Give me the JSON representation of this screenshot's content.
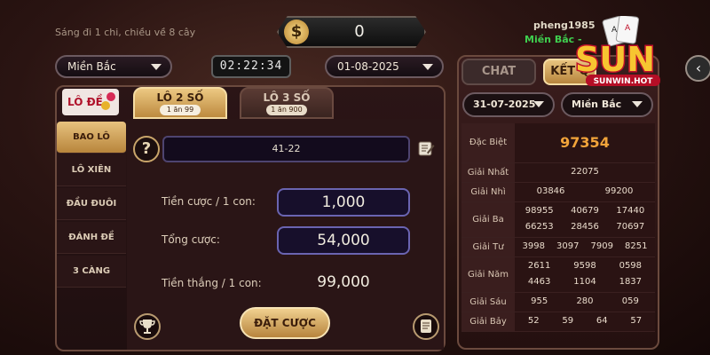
{
  "header": {
    "marquee": "Sáng đi 1 chi, chiều về 8 cây",
    "balance": "0",
    "currency_icon": "dollar-icon",
    "username": "pheng1985",
    "region_tag": "Miền Bắc -",
    "logo_text": "SUN",
    "logo_sub": "SUNWIN.HOT"
  },
  "controls": {
    "region": "Miền Bắc",
    "timer": "02:22:34",
    "date": "01-08-2025"
  },
  "game": {
    "logo_text": "LÔ ĐỀ",
    "sidebar": [
      "BAO LÔ",
      "LÔ XIÊN",
      "ĐẦU ĐUÔI",
      "ĐÁNH ĐỀ",
      "3 CÀNG"
    ],
    "active_sidebar": 0,
    "tabs": [
      {
        "label": "LÔ 2 SỐ",
        "sub": "1 ăn 99",
        "active": true
      },
      {
        "label": "LÔ 3 SỐ",
        "sub": "1 ăn 900",
        "active": false
      }
    ],
    "selected_numbers": "41-22",
    "bet_per_label": "Tiền cược / 1 con:",
    "bet_per_value": "1,000",
    "total_label": "Tổng cược:",
    "total_value": "54,000",
    "win_label": "Tiền thắng / 1 con:",
    "win_value": "99,000",
    "submit_label": "ĐẶT CƯỢC"
  },
  "results": {
    "tabs": [
      "CHAT",
      "KẾT Q"
    ],
    "active_tab": 1,
    "date": "31-07-2025",
    "region": "Miền Bắc",
    "rows": [
      {
        "label": "Đặc Biệt",
        "values": [
          "97354"
        ]
      },
      {
        "label": "Giải Nhất",
        "values": [
          "22075"
        ]
      },
      {
        "label": "Giải Nhì",
        "values": [
          "03846",
          "99200"
        ]
      },
      {
        "label": "Giải Ba",
        "values": [
          "98955",
          "40679",
          "17440",
          "66253",
          "28456",
          "70697"
        ]
      },
      {
        "label": "Giải Tư",
        "values": [
          "3998",
          "3097",
          "7909",
          "8251"
        ]
      },
      {
        "label": "Giải Năm",
        "values": [
          "2611",
          "9598",
          "0598",
          "4463",
          "1104",
          "1837"
        ]
      },
      {
        "label": "Giải Sáu",
        "values": [
          "955",
          "280",
          "059"
        ]
      },
      {
        "label": "Giải Bảy",
        "values": [
          "52",
          "59",
          "64",
          "57"
        ]
      }
    ]
  },
  "colors": {
    "accent_gold": "#e7c27f",
    "special_prize": "#f2a43a",
    "online_green": "#3fcf4f"
  }
}
